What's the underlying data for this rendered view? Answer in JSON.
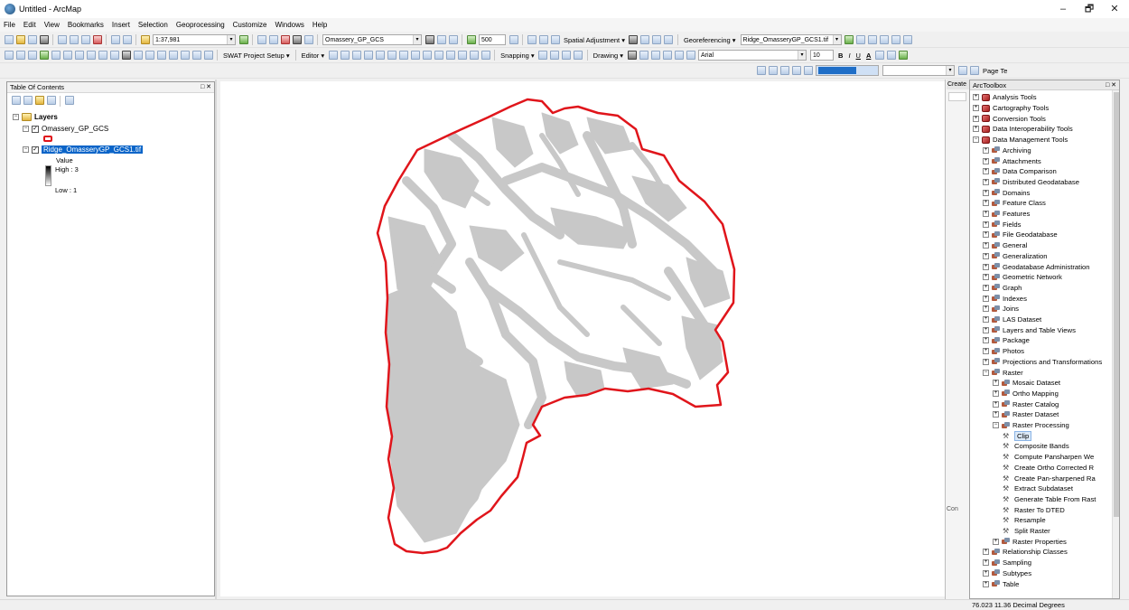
{
  "window": {
    "title": "Untitled - ArcMap",
    "minimize": "–",
    "maximize": "🗗",
    "close": "✕"
  },
  "menu": [
    "File",
    "Edit",
    "View",
    "Bookmarks",
    "Insert",
    "Selection",
    "Geoprocessing",
    "Customize",
    "Windows",
    "Help"
  ],
  "toolbar1": {
    "scale": "1:37,981",
    "layer_combo": "Omassery_GP_GCS",
    "resolution": "500",
    "spatial_adjustment": "Spatial Adjustment ▾",
    "georeferencing": "Georeferencing ▾",
    "georef_layer": "Ridge_OmasseryGP_GCS1.tif"
  },
  "toolbar2": {
    "swat": "SWAT Project Setup ▾",
    "editor": "Editor ▾",
    "snapping": "Snapping ▾",
    "drawing": "Drawing ▾",
    "font": "Arial",
    "font_size": "10",
    "bold": "B",
    "italic": "I",
    "underline": "U",
    "font_color": "A"
  },
  "toc": {
    "title": "Table Of Contents",
    "close": "□ ✕",
    "layers_label": "Layers",
    "layer1": "Omassery_GP_GCS",
    "layer2": "Ridge_OmasseryGP_GCS1.tif",
    "value_label": "Value",
    "high": "High : 3",
    "low": "Low : 1"
  },
  "create_panel": {
    "tab": "Create",
    "page_text": "Page Te",
    "con": "Con"
  },
  "toolbox": {
    "title": "ArcToolbox",
    "close": "□ ✕",
    "items": [
      {
        "label": "Analysis Tools",
        "level": 0,
        "kind": "box",
        "pm": "+"
      },
      {
        "label": "Cartography Tools",
        "level": 0,
        "kind": "box",
        "pm": "+"
      },
      {
        "label": "Conversion Tools",
        "level": 0,
        "kind": "box",
        "pm": "+"
      },
      {
        "label": "Data Interoperability Tools",
        "level": 0,
        "kind": "box",
        "pm": "+"
      },
      {
        "label": "Data Management Tools",
        "level": 0,
        "kind": "box",
        "pm": "−"
      },
      {
        "label": "Archiving",
        "level": 1,
        "kind": "tset",
        "pm": "+"
      },
      {
        "label": "Attachments",
        "level": 1,
        "kind": "tset",
        "pm": "+"
      },
      {
        "label": "Data Comparison",
        "level": 1,
        "kind": "tset",
        "pm": "+"
      },
      {
        "label": "Distributed Geodatabase",
        "level": 1,
        "kind": "tset",
        "pm": "+"
      },
      {
        "label": "Domains",
        "level": 1,
        "kind": "tset",
        "pm": "+"
      },
      {
        "label": "Feature Class",
        "level": 1,
        "kind": "tset",
        "pm": "+"
      },
      {
        "label": "Features",
        "level": 1,
        "kind": "tset",
        "pm": "+"
      },
      {
        "label": "Fields",
        "level": 1,
        "kind": "tset",
        "pm": "+"
      },
      {
        "label": "File Geodatabase",
        "level": 1,
        "kind": "tset",
        "pm": "+"
      },
      {
        "label": "General",
        "level": 1,
        "kind": "tset",
        "pm": "+"
      },
      {
        "label": "Generalization",
        "level": 1,
        "kind": "tset",
        "pm": "+"
      },
      {
        "label": "Geodatabase Administration",
        "level": 1,
        "kind": "tset",
        "pm": "+"
      },
      {
        "label": "Geometric Network",
        "level": 1,
        "kind": "tset",
        "pm": "+"
      },
      {
        "label": "Graph",
        "level": 1,
        "kind": "tset",
        "pm": "+"
      },
      {
        "label": "Indexes",
        "level": 1,
        "kind": "tset",
        "pm": "+"
      },
      {
        "label": "Joins",
        "level": 1,
        "kind": "tset",
        "pm": "+"
      },
      {
        "label": "LAS Dataset",
        "level": 1,
        "kind": "tset",
        "pm": "+"
      },
      {
        "label": "Layers and Table Views",
        "level": 1,
        "kind": "tset",
        "pm": "+"
      },
      {
        "label": "Package",
        "level": 1,
        "kind": "tset",
        "pm": "+"
      },
      {
        "label": "Photos",
        "level": 1,
        "kind": "tset",
        "pm": "+"
      },
      {
        "label": "Projections and Transformations",
        "level": 1,
        "kind": "tset",
        "pm": "+"
      },
      {
        "label": "Raster",
        "level": 1,
        "kind": "tset",
        "pm": "−"
      },
      {
        "label": "Mosaic Dataset",
        "level": 2,
        "kind": "tset",
        "pm": "+"
      },
      {
        "label": "Ortho Mapping",
        "level": 2,
        "kind": "tset",
        "pm": "+"
      },
      {
        "label": "Raster Catalog",
        "level": 2,
        "kind": "tset",
        "pm": "+"
      },
      {
        "label": "Raster Dataset",
        "level": 2,
        "kind": "tset",
        "pm": "+"
      },
      {
        "label": "Raster Processing",
        "level": 2,
        "kind": "tset",
        "pm": "−"
      },
      {
        "label": "Clip",
        "level": 3,
        "kind": "tool",
        "pm": "",
        "selected": true
      },
      {
        "label": "Composite Bands",
        "level": 3,
        "kind": "tool",
        "pm": ""
      },
      {
        "label": "Compute Pansharpen We",
        "level": 3,
        "kind": "tool",
        "pm": ""
      },
      {
        "label": "Create Ortho Corrected R",
        "level": 3,
        "kind": "tool",
        "pm": ""
      },
      {
        "label": "Create Pan-sharpened Ra",
        "level": 3,
        "kind": "tool",
        "pm": ""
      },
      {
        "label": "Extract Subdataset",
        "level": 3,
        "kind": "tool",
        "pm": ""
      },
      {
        "label": "Generate Table From Rast",
        "level": 3,
        "kind": "tool",
        "pm": ""
      },
      {
        "label": "Raster To DTED",
        "level": 3,
        "kind": "tool",
        "pm": ""
      },
      {
        "label": "Resample",
        "level": 3,
        "kind": "tool",
        "pm": ""
      },
      {
        "label": "Split Raster",
        "level": 3,
        "kind": "tool",
        "pm": ""
      },
      {
        "label": "Raster Properties",
        "level": 2,
        "kind": "tset",
        "pm": "+"
      },
      {
        "label": "Relationship Classes",
        "level": 1,
        "kind": "tset",
        "pm": "+"
      },
      {
        "label": "Sampling",
        "level": 1,
        "kind": "tset",
        "pm": "+"
      },
      {
        "label": "Subtypes",
        "level": 1,
        "kind": "tset",
        "pm": "+"
      },
      {
        "label": "Table",
        "level": 1,
        "kind": "tset",
        "pm": "+"
      }
    ]
  },
  "status": {
    "coords": "76.023  11.36 Decimal Degrees"
  },
  "colors": {
    "boundary": "#e0151b",
    "raster_fill": "#c8c8c8",
    "selection": "#0a64c8"
  }
}
